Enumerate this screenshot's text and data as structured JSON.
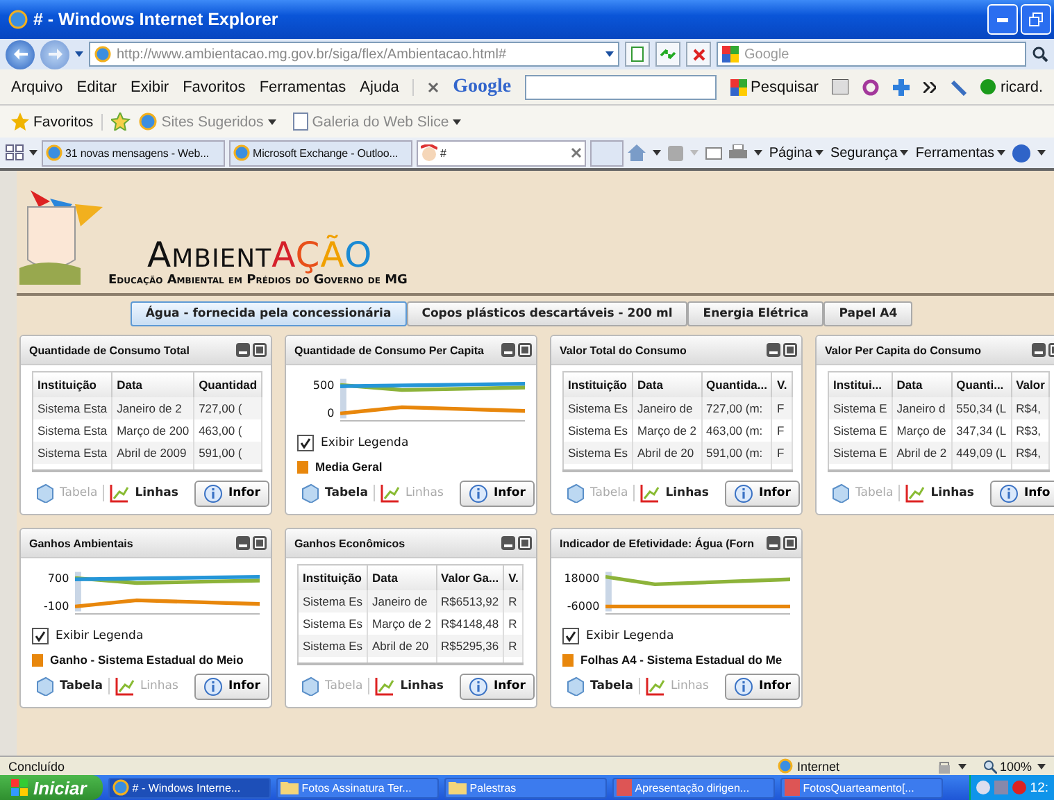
{
  "window": {
    "title": "# - Windows Internet Explorer"
  },
  "address_bar": {
    "url": "http://www.ambientacao.mg.gov.br/siga/flex/Ambientacao.html#",
    "search_placeholder": "Google"
  },
  "menu": [
    "Arquivo",
    "Editar",
    "Exibir",
    "Favoritos",
    "Ferramentas",
    "Ajuda"
  ],
  "google_toolbar": {
    "logo": "Google",
    "search_button": "Pesquisar",
    "user": "ricard."
  },
  "favorites_bar": {
    "favorites": "Favoritos",
    "links": [
      "Sites Sugeridos",
      "Galeria do Web Slice"
    ]
  },
  "browser_tabs": [
    {
      "label": "31 novas mensagens - Web...",
      "selected": false
    },
    {
      "label": "Microsoft Exchange - Outloo...",
      "selected": false
    },
    {
      "label": "#",
      "selected": true
    }
  ],
  "command_bar": [
    "Página",
    "Segurança",
    "Ferramentas"
  ],
  "site": {
    "logo_parts": [
      "Ambient",
      "A",
      "Ç",
      "Ã",
      "O"
    ],
    "tagline": "Educação Ambiental em Prédios do Governo de MG"
  },
  "category_tabs": [
    {
      "label": "Água - fornecida pela concessionária",
      "selected": true
    },
    {
      "label": "Copos plásticos descartáveis - 200 ml",
      "selected": false
    },
    {
      "label": "Energia Elétrica",
      "selected": false
    },
    {
      "label": "Papel A4",
      "selected": false
    }
  ],
  "panels": [
    {
      "title": "Quantidade de Consumo Total",
      "kind": "table",
      "columns": [
        "Instituição",
        "Data",
        "Quantidad"
      ],
      "rows": [
        [
          "Sistema Esta",
          "Janeiro de 2",
          "727,00 ("
        ],
        [
          "Sistema Esta",
          "Março de 200",
          "463,00 ("
        ],
        [
          "Sistema Esta",
          "Abril de 2009",
          "591,00 ("
        ]
      ],
      "view_buttons": [
        {
          "label": "Tabela",
          "selected": true
        },
        {
          "label": "Linhas",
          "selected": false
        }
      ],
      "info_button": "Infor"
    },
    {
      "title": "Quantidade de Consumo Per Capita",
      "kind": "chart",
      "y_ticks": [
        "500",
        "0"
      ],
      "legend_toggle": {
        "label": "Exibir Legenda",
        "checked": true
      },
      "legend": [
        {
          "label": "Media Geral",
          "color": "#e8870c"
        }
      ],
      "view_buttons": [
        {
          "label": "Tabela",
          "selected": false
        },
        {
          "label": "Linhas",
          "selected": true
        }
      ],
      "info_button": "Infor"
    },
    {
      "title": "Valor Total do Consumo",
      "kind": "table",
      "columns": [
        "Instituição",
        "Data",
        "Quantida...",
        "V."
      ],
      "rows": [
        [
          "Sistema Es",
          "Janeiro de",
          "727,00 (m:",
          "F"
        ],
        [
          "Sistema Es",
          "Março de 2",
          "463,00 (m:",
          "F"
        ],
        [
          "Sistema Es",
          "Abril de 20",
          "591,00 (m:",
          "F"
        ]
      ],
      "view_buttons": [
        {
          "label": "Tabela",
          "selected": true
        },
        {
          "label": "Linhas",
          "selected": false
        }
      ],
      "info_button": "Infor"
    },
    {
      "title": "Valor Per Capita do Consumo",
      "kind": "table",
      "columns": [
        "Institui...",
        "Data",
        "Quanti...",
        "Valor"
      ],
      "rows": [
        [
          "Sistema E",
          "Janeiro d",
          "550,34 (L",
          "R$4,"
        ],
        [
          "Sistema E",
          "Março de",
          "347,34 (L",
          "R$3,"
        ],
        [
          "Sistema E",
          "Abril de 2",
          "449,09 (L",
          "R$4,"
        ]
      ],
      "view_buttons": [
        {
          "label": "Tabela",
          "selected": true
        },
        {
          "label": "Linhas",
          "selected": false
        }
      ],
      "info_button": "Info"
    },
    {
      "title": "Ganhos Ambientais",
      "kind": "chart",
      "y_ticks": [
        "700",
        "-100"
      ],
      "legend_toggle": {
        "label": "Exibir Legenda",
        "checked": true
      },
      "legend": [
        {
          "label": "Ganho - Sistema Estadual do Meio",
          "color": "#e8870c"
        }
      ],
      "view_buttons": [
        {
          "label": "Tabela",
          "selected": false
        },
        {
          "label": "Linhas",
          "selected": true
        }
      ],
      "info_button": "Infor"
    },
    {
      "title": "Ganhos Econômicos",
      "kind": "table",
      "columns": [
        "Instituição",
        "Data",
        "Valor Ga...",
        "V."
      ],
      "rows": [
        [
          "Sistema Es",
          "Janeiro de",
          "R$6513,92",
          "R"
        ],
        [
          "Sistema Es",
          "Março de 2",
          "R$4148,48",
          "R"
        ],
        [
          "Sistema Es",
          "Abril de 20",
          "R$5295,36",
          "R"
        ]
      ],
      "view_buttons": [
        {
          "label": "Tabela",
          "selected": true
        },
        {
          "label": "Linhas",
          "selected": false
        }
      ],
      "info_button": "Infor"
    },
    {
      "title": "Indicador de Efetividade: Água (Forn",
      "kind": "chart",
      "y_ticks": [
        "18000",
        "-6000"
      ],
      "legend_toggle": {
        "label": "Exibir Legenda",
        "checked": true
      },
      "legend": [
        {
          "label": "Folhas A4 - Sistema Estadual do Me",
          "color": "#e8870c"
        }
      ],
      "view_buttons": [
        {
          "label": "Tabela",
          "selected": false
        },
        {
          "label": "Linhas",
          "selected": true
        }
      ],
      "info_button": "Infor"
    }
  ],
  "status_bar": {
    "text": "Concluído",
    "zone": "Internet",
    "zoom": "100%"
  },
  "taskbar": {
    "start": "Iniciar",
    "items": [
      "# - Windows Interne...",
      "Fotos Assinatura Ter...",
      "Palestras",
      "Apresentação dirigen...",
      "FotosQuarteamento[..."
    ],
    "clock": "12:"
  }
}
